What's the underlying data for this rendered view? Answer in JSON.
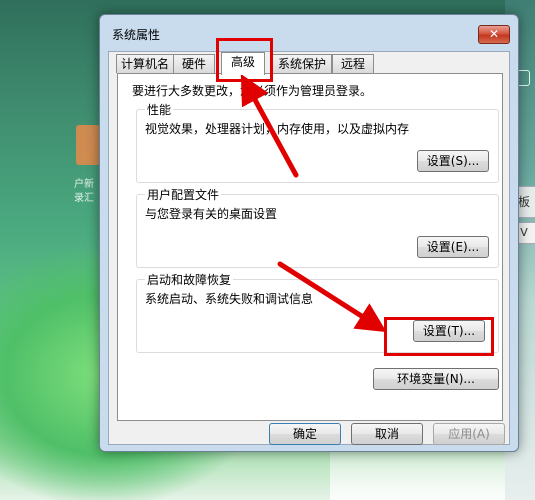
{
  "desktop": {
    "app_label": "户新\n录汇",
    "right_fragment_1": "板",
    "right_fragment_2": "V"
  },
  "window": {
    "title": "系统属性",
    "close_label": "✕"
  },
  "tabs": [
    {
      "label": "计算机名",
      "active": false
    },
    {
      "label": "硬件",
      "active": false
    },
    {
      "label": "高级",
      "active": true
    },
    {
      "label": "系统保护",
      "active": false
    },
    {
      "label": "远程",
      "active": false
    }
  ],
  "advanced": {
    "admin_notice": "要进行大多数更改，您必须作为管理员登录。",
    "performance": {
      "title": "性能",
      "desc": "视觉效果，处理器计划，内存使用，以及虚拟内存",
      "button": "设置(S)..."
    },
    "user_profiles": {
      "title": "用户配置文件",
      "desc": "与您登录有关的桌面设置",
      "button": "设置(E)..."
    },
    "startup_recovery": {
      "title": "启动和故障恢复",
      "desc": "系统启动、系统失败和调试信息",
      "button": "设置(T)..."
    },
    "env_button": "环境变量(N)..."
  },
  "footer": {
    "ok": "确定",
    "cancel": "取消",
    "apply": "应用(A)"
  },
  "annotation_color": "#e00000"
}
